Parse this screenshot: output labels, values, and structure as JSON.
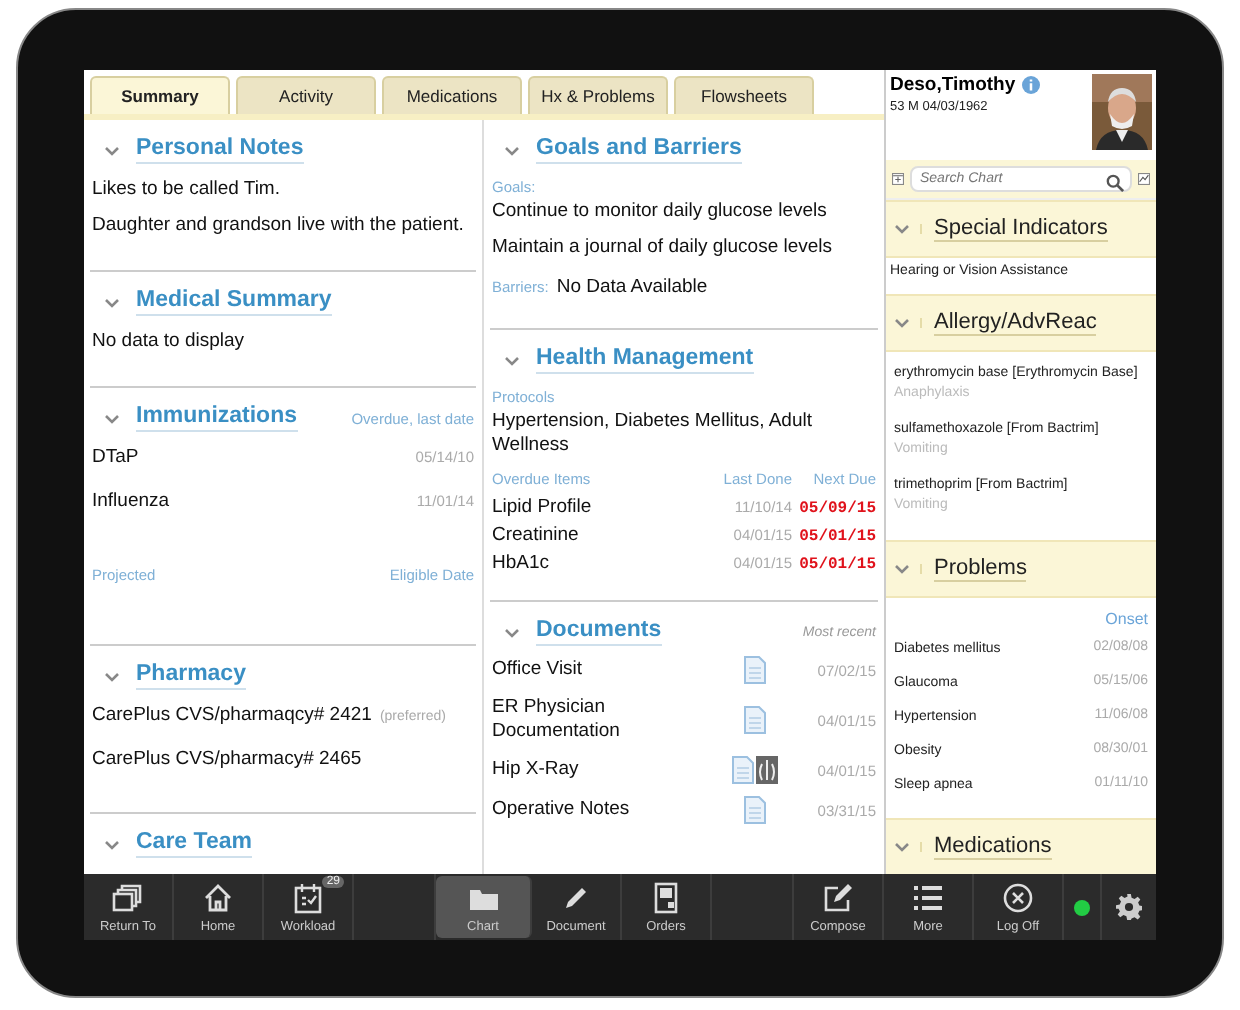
{
  "tabs": [
    {
      "label": "Summary",
      "selected": true
    },
    {
      "label": "Activity",
      "selected": false
    },
    {
      "label": "Medications",
      "selected": false
    },
    {
      "label": "Hx & Problems",
      "selected": false
    },
    {
      "label": "Flowsheets",
      "selected": false
    }
  ],
  "personal_notes": {
    "title": "Personal Notes",
    "lines": [
      "Likes to be called Tim.",
      "Daughter and grandson live with the patient."
    ]
  },
  "medical_summary": {
    "title": "Medical Summary",
    "text": "No data to display"
  },
  "immunizations": {
    "title": "Immunizations",
    "header_note": "Overdue, last date",
    "items": [
      {
        "name": "DTaP",
        "date": "05/14/10"
      },
      {
        "name": "Influenza",
        "date": "11/01/14"
      }
    ],
    "projected_label": "Projected",
    "eligible_label": "Eligible Date"
  },
  "pharmacy": {
    "title": "Pharmacy",
    "items": [
      {
        "name": "CarePlus CVS/pharmaqcy# 2421",
        "note": "(preferred)"
      },
      {
        "name": "CarePlus CVS/pharmacy# 2465"
      }
    ]
  },
  "care_team": {
    "title": "Care Team"
  },
  "goals_and_barriers": {
    "title": "Goals and Barriers",
    "goals_label": "Goals:",
    "goals": [
      "Continue to monitor daily glucose levels",
      "Maintain a journal of daily glucose levels"
    ],
    "barriers_label": "Barriers:",
    "barriers": "No Data Available"
  },
  "health_management": {
    "title": "Health Management",
    "protocols_label": "Protocols",
    "protocols": "Hypertension,  Diabetes Mellitus,  Adult Wellness",
    "columns": [
      "Overdue Items",
      "Last Done",
      "Next Due"
    ],
    "items": [
      {
        "name": "Lipid Profile",
        "last_done": "11/10/14",
        "next_due": "05/09/15"
      },
      {
        "name": "Creatinine",
        "last_done": "04/01/15",
        "next_due": "05/01/15"
      },
      {
        "name": "HbA1c",
        "last_done": "04/01/15",
        "next_due": "05/01/15"
      }
    ]
  },
  "documents": {
    "title": "Documents",
    "header_note": "Most recent",
    "items": [
      {
        "name": "Office Visit",
        "kind": "note",
        "date": "07/02/15"
      },
      {
        "name": "ER Physician Documentation",
        "kind": "note",
        "date": "04/01/15"
      },
      {
        "name": "Hip X-Ray",
        "kind": "xray",
        "date": "04/01/15"
      },
      {
        "name": "Operative Notes",
        "kind": "note",
        "date": "03/31/15"
      }
    ]
  },
  "patient": {
    "name": "Deso,Timothy",
    "details": "53 M 04/03/1962",
    "search_placeholder": "Search Chart"
  },
  "special_indicators": {
    "title": "Special Indicators",
    "items": [
      "Hearing or Vision Assistance"
    ]
  },
  "allergies": {
    "title": "Allergy/AdvReac",
    "items": [
      {
        "name": "erythromycin base [Erythromycin Base]",
        "reaction": "Anaphylaxis"
      },
      {
        "name": "sulfamethoxazole [From Bactrim]",
        "reaction": "Vomiting"
      },
      {
        "name": "trimethoprim [From Bactrim]",
        "reaction": "Vomiting"
      }
    ]
  },
  "problems": {
    "title": "Problems",
    "column": "Onset",
    "items": [
      {
        "name": "Diabetes mellitus",
        "date": "02/08/08"
      },
      {
        "name": "Glaucoma",
        "date": "05/15/06"
      },
      {
        "name": "Hypertension",
        "date": "11/06/08"
      },
      {
        "name": "Obesity",
        "date": "08/30/01"
      },
      {
        "name": "Sleep apnea",
        "date": "01/11/10"
      }
    ]
  },
  "medications": {
    "title": "Medications"
  },
  "toolbar": {
    "items": [
      {
        "kind": "button",
        "label": "Return To",
        "selected": false
      },
      {
        "kind": "button",
        "label": "Home",
        "selected": false
      },
      {
        "kind": "button",
        "label": "Workload",
        "selected": false,
        "badge": "29"
      },
      {
        "kind": "spacer"
      },
      {
        "kind": "button",
        "label": "Chart",
        "selected": true
      },
      {
        "kind": "button",
        "label": "Document",
        "selected": false
      },
      {
        "kind": "button",
        "label": "Orders",
        "selected": false
      },
      {
        "kind": "spacer"
      },
      {
        "kind": "button",
        "label": "Compose",
        "selected": false
      },
      {
        "kind": "button",
        "label": "More",
        "selected": false
      },
      {
        "kind": "button",
        "label": "Log Off",
        "selected": false
      }
    ],
    "online": true
  }
}
